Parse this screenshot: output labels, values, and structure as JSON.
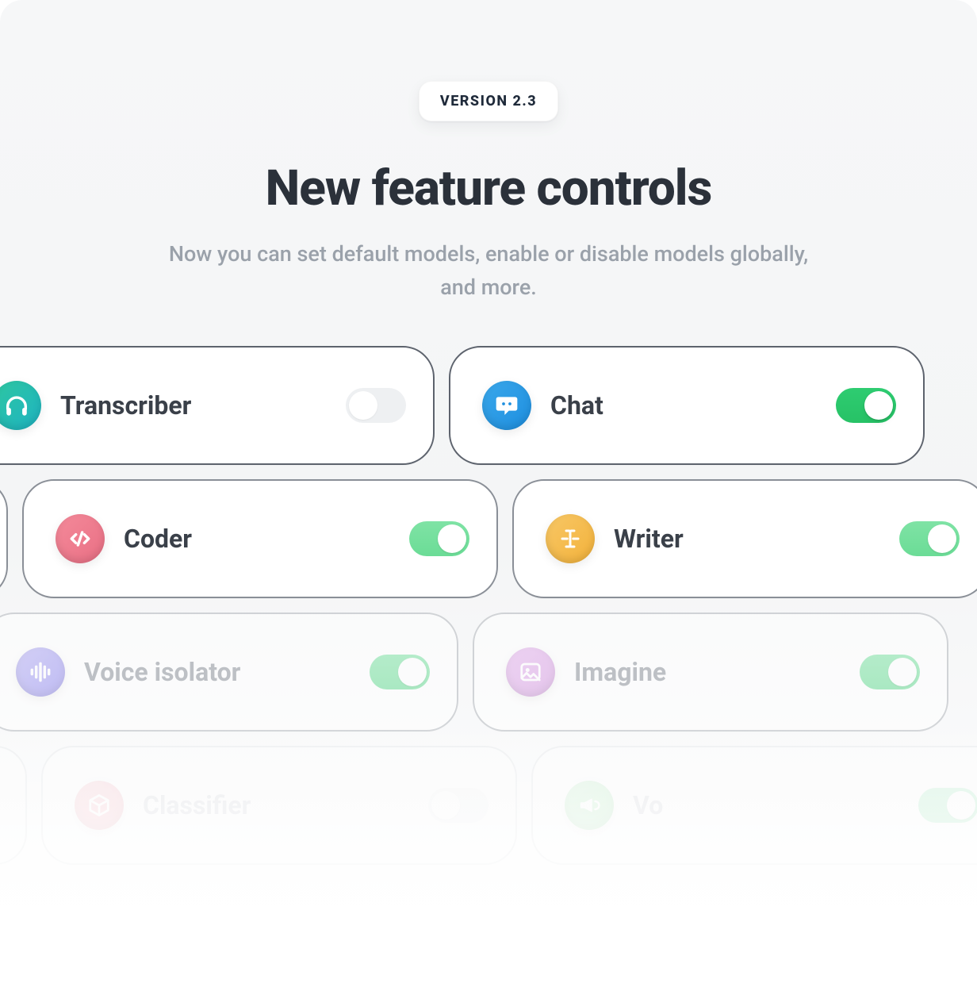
{
  "header": {
    "badge": "VERSION 2.3",
    "title": "New feature controls",
    "subtitle": "Now you can set default models, enable or disable models globally, and more."
  },
  "cards": {
    "a": {
      "label": "",
      "on": true
    },
    "transcriber": {
      "label": "Transcriber",
      "on": false
    },
    "chat": {
      "label": "Chat",
      "on": true
    },
    "b": {
      "label": "",
      "on": true
    },
    "coder": {
      "label": "Coder",
      "on": true
    },
    "writer": {
      "label": "Writer",
      "on": true
    },
    "c": {
      "label": "",
      "on": false
    },
    "voice_isolator": {
      "label": "Voice isolator",
      "on": true
    },
    "imagine": {
      "label": "Imagine",
      "on": true
    },
    "d": {
      "label": "",
      "on": true
    },
    "classifier": {
      "label": "Classifier",
      "on": false
    },
    "voice2": {
      "label": "Vo",
      "on": true
    }
  }
}
